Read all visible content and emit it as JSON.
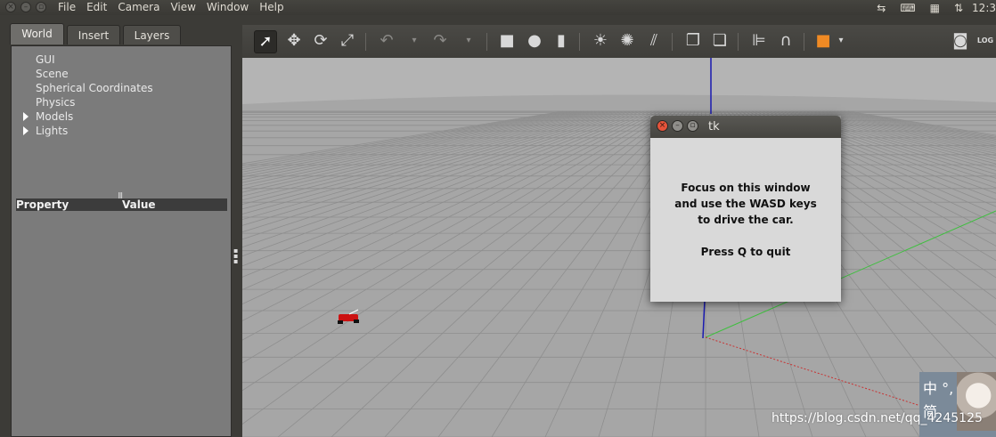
{
  "menubar": {
    "items": [
      "File",
      "Edit",
      "Camera",
      "View",
      "Window",
      "Help"
    ],
    "clock": "12:3"
  },
  "left_panel": {
    "tabs": [
      "World",
      "Insert",
      "Layers"
    ],
    "active_tab": "World",
    "tree": [
      {
        "label": "GUI",
        "expandable": false
      },
      {
        "label": "Scene",
        "expandable": false
      },
      {
        "label": "Spherical Coordinates",
        "expandable": false
      },
      {
        "label": "Physics",
        "expandable": false
      },
      {
        "label": "Models",
        "expandable": true
      },
      {
        "label": "Lights",
        "expandable": true
      }
    ],
    "property_header": {
      "property": "Property",
      "value": "Value"
    }
  },
  "toolbar": {
    "tools": [
      "select-tool",
      "translate-tool",
      "rotate-tool",
      "scale-tool",
      "undo",
      "redo",
      "box-shape",
      "sphere-shape",
      "cylinder-shape",
      "point-light",
      "spot-light",
      "directional-light",
      "copy",
      "paste",
      "align",
      "magnet",
      "change-view",
      "screenshot",
      "log"
    ],
    "log_label": "LOG"
  },
  "dialog": {
    "title": "tk",
    "lines": [
      "Focus on this window",
      "and use the WASD keys",
      "to drive the car.",
      "",
      "Press Q to quit"
    ]
  },
  "overlay": {
    "ime_top": "中 °,",
    "ime_bottom": "简",
    "watermark": "https://blog.csdn.net/qq_4245125"
  },
  "colors": {
    "ground": "#a6a6a6",
    "grid_line": "#8e8e8e",
    "sky": "#b2b2b2",
    "z_axis": "#1a1ab0",
    "y_axis": "#3fbf3f",
    "x_axis": "#c83232",
    "car": "#cc1111"
  }
}
